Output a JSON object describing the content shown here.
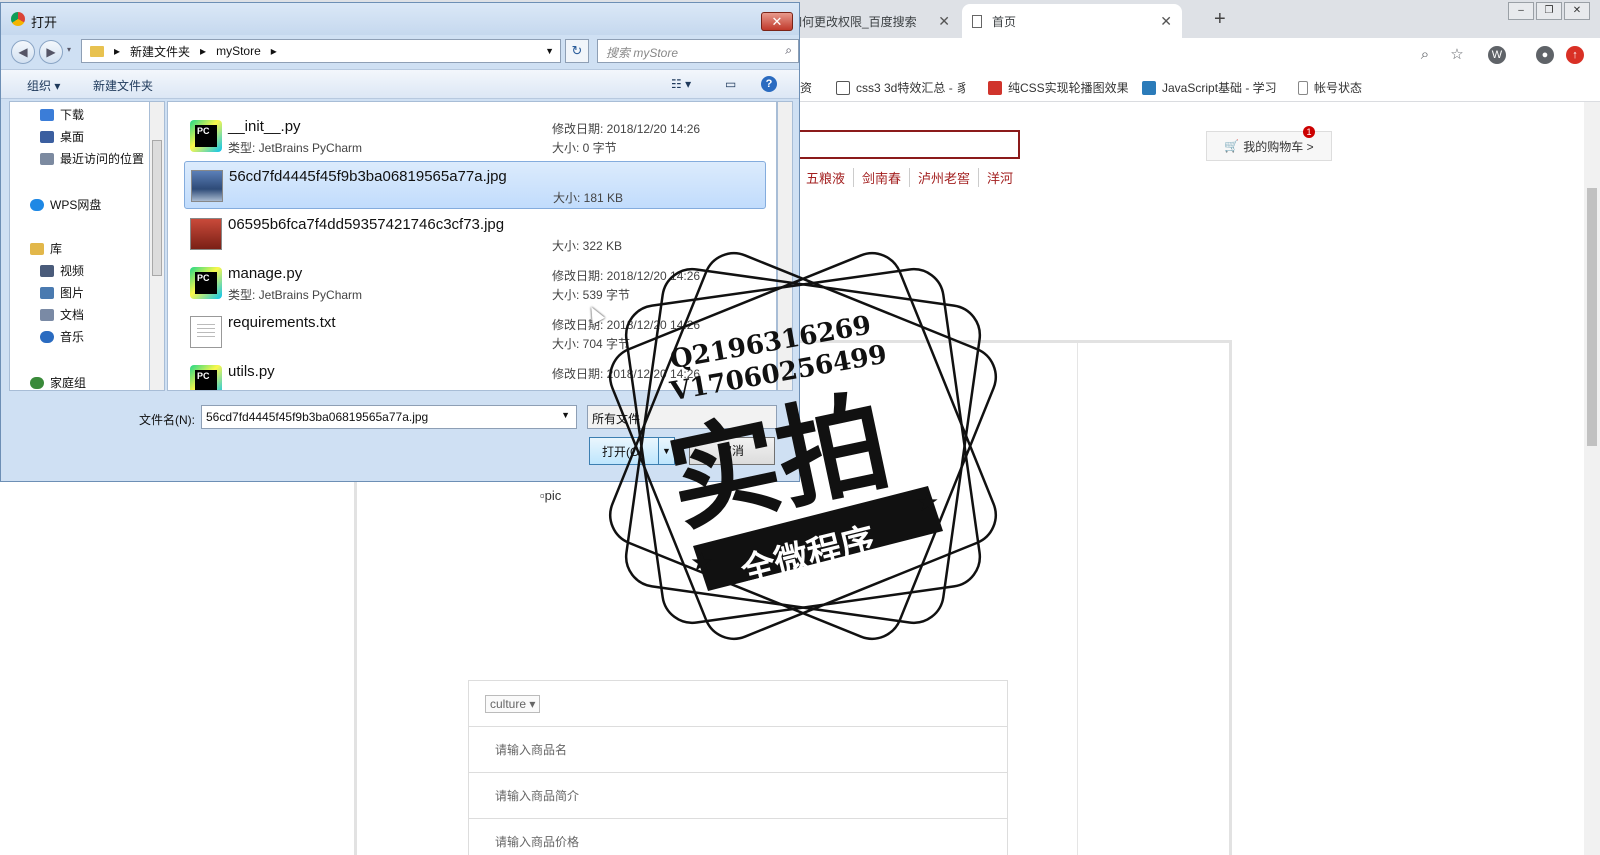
{
  "browser": {
    "tabs": [
      {
        "title": "如何更改权限_百度搜索",
        "close": "✕"
      },
      {
        "title": "首页",
        "close": "✕"
      }
    ],
    "new_tab": "+",
    "bookmarks": [
      {
        "label": "资",
        "color": "#888888"
      },
      {
        "label": "css3 3d特效汇总 - 豸",
        "color": "#555555"
      },
      {
        "label": "纯CSS实现轮播图效果",
        "color": "#d0342c"
      },
      {
        "label": "JavaScript基础 - 学习",
        "color": "#2b7bb9"
      },
      {
        "label": "帐号状态",
        "color": "#888888"
      }
    ]
  },
  "page": {
    "cart_label": "我的购物车 >",
    "cart_count": "1",
    "categories": [
      "五粮液",
      "剑南春",
      "泸州老窖",
      "洋河"
    ],
    "pic_alt": "pic",
    "form": {
      "category_select": "culture ▾",
      "name_placeholder": "请输入商品名",
      "intro_placeholder": "请输入商品简介",
      "price_placeholder": "请输入商品价格"
    }
  },
  "dialog": {
    "title": "打开",
    "close": "✕",
    "breadcrumb": [
      "新建文件夹",
      "myStore"
    ],
    "search_placeholder": "搜索 myStore",
    "toolbar": {
      "organize": "组织 ▾",
      "new_folder": "新建文件夹",
      "help": "?"
    },
    "nav": [
      {
        "label": "下载",
        "color": "#3b7dd8"
      },
      {
        "label": "桌面",
        "color": "#3b5fa0"
      },
      {
        "label": "最近访问的位置",
        "color": "#7c8aa0"
      },
      {
        "label": "WPS网盘",
        "color": "#1e88e5"
      },
      {
        "label": "库",
        "color": "#e2b74a"
      },
      {
        "label": "视频",
        "color": "#4a5b7a"
      },
      {
        "label": "图片",
        "color": "#4a7ab0"
      },
      {
        "label": "文档",
        "color": "#7a8aa5"
      },
      {
        "label": "音乐",
        "color": "#2a6bc0"
      },
      {
        "label": "家庭组",
        "color": "#3a8a3a"
      }
    ],
    "files": [
      {
        "name": "__init__.py",
        "type": "类型: JetBrains PyCharm",
        "date": "修改日期: 2018/12/20 14:26",
        "size": "大小: 0 字节",
        "icon": "pycharm"
      },
      {
        "name": "56cd7fd4445f45f9b3ba06819565a77a.jpg",
        "type": "",
        "date": "",
        "size": "大小: 181 KB",
        "icon": "image"
      },
      {
        "name": "06595b6fca7f4dd59357421746c3cf73.jpg",
        "type": "",
        "date": "",
        "size": "大小: 322 KB",
        "icon": "image"
      },
      {
        "name": "manage.py",
        "type": "类型: JetBrains PyCharm",
        "date": "修改日期: 2018/12/20 14:26",
        "size": "大小: 539 字节",
        "icon": "pycharm"
      },
      {
        "name": "requirements.txt",
        "type": "",
        "date": "修改日期: 2018/12/20 14:26",
        "size": "大小: 704 字节",
        "icon": "text"
      },
      {
        "name": "utils.py",
        "type": "",
        "date": "修改日期: 2018/12/20 14:26",
        "size": "",
        "icon": "pycharm"
      }
    ],
    "filename_label": "文件名(N):",
    "filename_value": "56cd7fd4445f45f9b3ba06819565a77a.jpg",
    "filter_value": "所有文件",
    "open_label": "打开(O)",
    "cancel_label": "取消"
  },
  "watermark": {
    "line1": "Q2196316269",
    "line2": "V17060256499",
    "main": "实拍",
    "banner": "全微程序"
  },
  "colors": {
    "accent": "#8b1a1a",
    "selection": "#c1dcfc",
    "dialog_bg": "#cfe0f3"
  }
}
